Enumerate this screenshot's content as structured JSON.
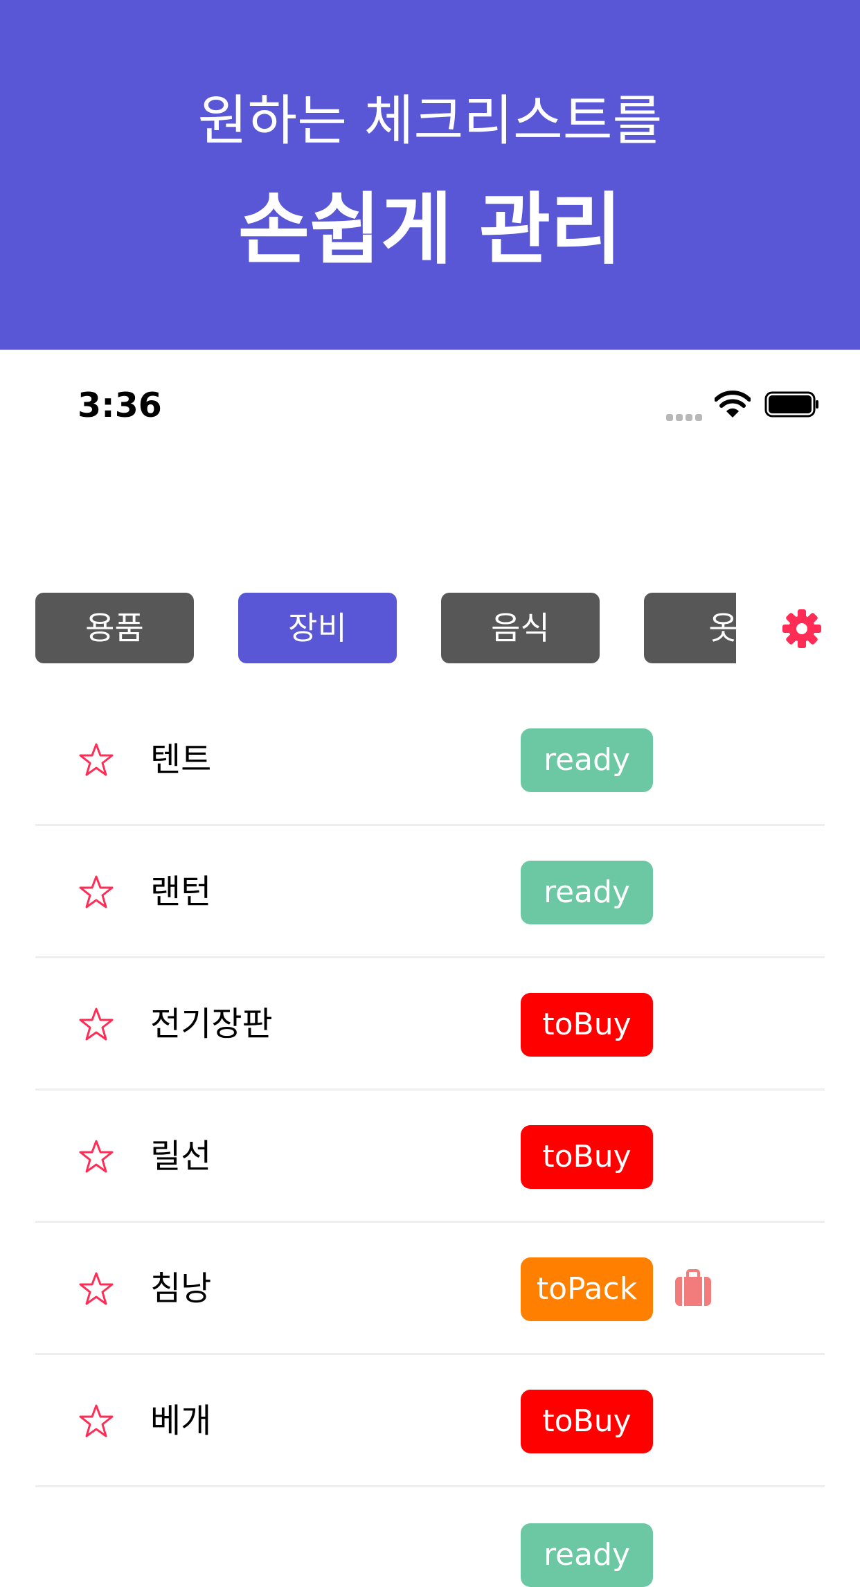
{
  "banner": {
    "line1": "원하는 체크리스트를",
    "line2": "손쉽게 관리",
    "background": "#5957d5"
  },
  "status_bar": {
    "time": "3:36",
    "icons": [
      "signal-icon",
      "wifi-icon",
      "battery-icon"
    ]
  },
  "tabs": [
    {
      "label": "용품",
      "active": false
    },
    {
      "label": "장비",
      "active": true
    },
    {
      "label": "음식",
      "active": false
    },
    {
      "label": "옷",
      "active": false
    }
  ],
  "settings_icon": "gear-icon",
  "colors": {
    "accent": "#5957d5",
    "tab_inactive": "#575757",
    "star": "#ff2d55",
    "ready": "#6bc8a3",
    "toBuy": "#ff0000",
    "toPack": "#ff7f00",
    "bag": "#f27b7b"
  },
  "items": [
    {
      "name": "텐트",
      "status": "ready",
      "bag": false
    },
    {
      "name": "랜턴",
      "status": "ready",
      "bag": false
    },
    {
      "name": "전기장판",
      "status": "toBuy",
      "bag": false
    },
    {
      "name": "릴선",
      "status": "toBuy",
      "bag": false
    },
    {
      "name": "침낭",
      "status": "toPack",
      "bag": true
    },
    {
      "name": "베개",
      "status": "toBuy",
      "bag": false
    }
  ],
  "partial_item": {
    "status": "ready"
  }
}
